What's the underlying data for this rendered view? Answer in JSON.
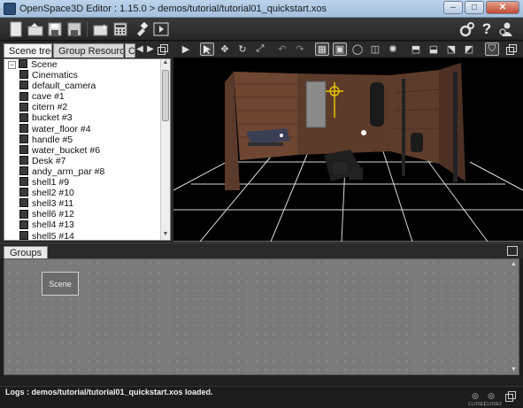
{
  "window": {
    "title": "OpenSpace3D Editor : 1.15.0 > demos/tutorial/tutorial01_quickstart.xos",
    "minimize": "–",
    "maximize": "□",
    "close": "✕"
  },
  "main_toolbar": {
    "icons": [
      "new-file-icon",
      "open-file-icon",
      "save-icon",
      "save-as-icon",
      "add-object-icon",
      "calculator-icon",
      "pin-icon",
      "run-icon",
      "settings-icon",
      "help-icon",
      "user-settings-icon"
    ],
    "help_glyph": "?"
  },
  "left_panel": {
    "tabs": [
      "Scene tree",
      "Group Resources",
      "C"
    ],
    "tree": {
      "root": "Scene",
      "items": [
        "Cinematics",
        "default_camera",
        "cave #1",
        "citern #2",
        "bucket #3",
        "water_floor #4",
        "handle #5",
        "water_bucket #6",
        "Desk #7",
        "andy_arm_par #8",
        "shell1 #9",
        "shell2 #10",
        "shell3 #11",
        "shell6 #12",
        "shell4 #13",
        "shell5 #14"
      ]
    }
  },
  "groups": {
    "tab": "Groups",
    "node": "Scene"
  },
  "status": {
    "logs": "Logs : demos/tutorial/tutorial01_quickstart.xos loaded.",
    "left_label": "CLOSE1",
    "right_label": "CLOSE2"
  }
}
